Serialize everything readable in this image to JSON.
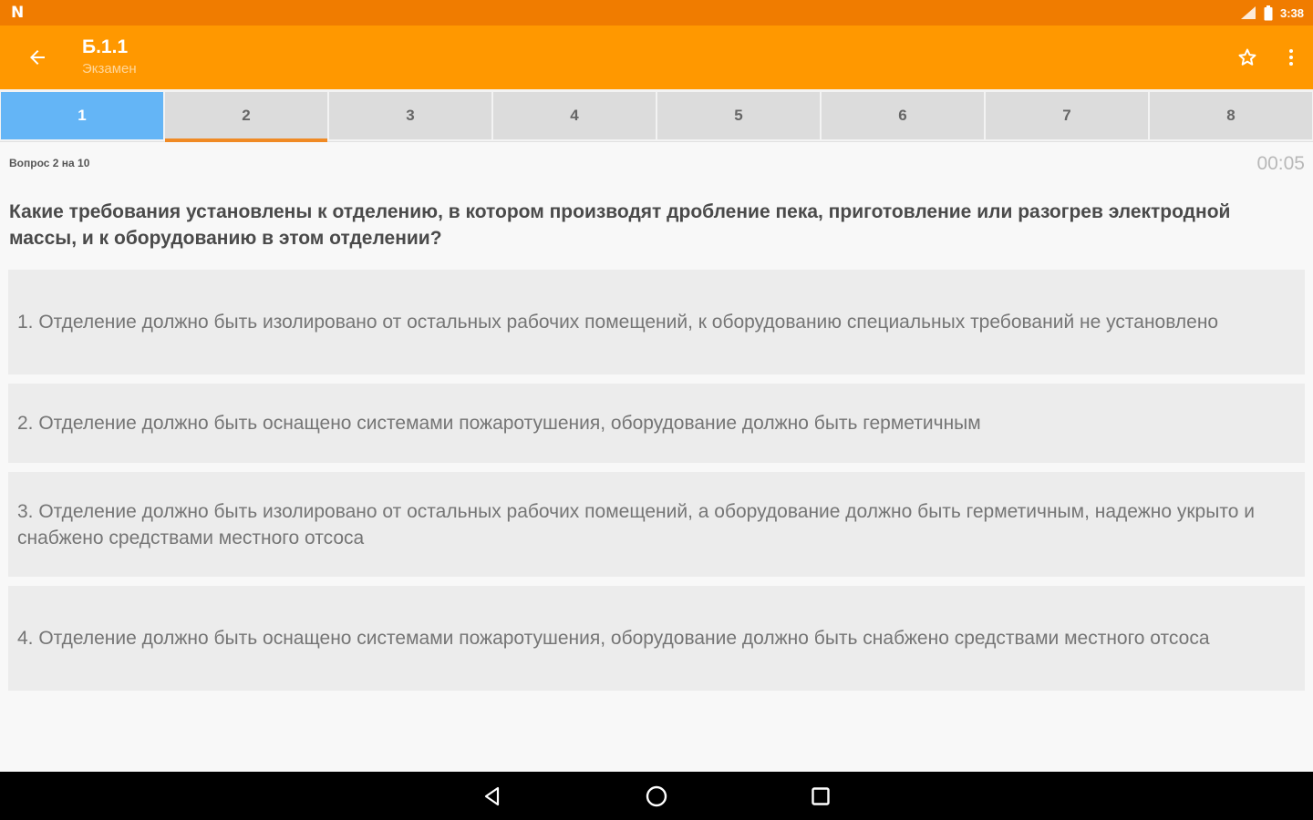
{
  "status_bar": {
    "notification_glyph": "N",
    "time": "3:38",
    "icons": [
      "signal-icon",
      "battery-icon"
    ]
  },
  "app_bar": {
    "title": "Б.1.1",
    "subtitle": "Экзамен",
    "icons": [
      "back-arrow-icon",
      "star-outline-icon",
      "more-vert-icon"
    ]
  },
  "tabs": [
    {
      "label": "1",
      "state": "current"
    },
    {
      "label": "2",
      "state": "visited"
    },
    {
      "label": "3",
      "state": "default"
    },
    {
      "label": "4",
      "state": "default"
    },
    {
      "label": "5",
      "state": "default"
    },
    {
      "label": "6",
      "state": "default"
    },
    {
      "label": "7",
      "state": "default"
    },
    {
      "label": "8",
      "state": "default"
    }
  ],
  "quiz": {
    "progress_text": "Вопрос 2 на 10",
    "timer": "00:05",
    "question": "Какие требования установлены к отделению, в котором производят дробление пека, приготовление или разогрев электродной массы, и к оборудованию в этом отделении?",
    "answers": [
      "1. Отделение должно быть изолировано от остальных рабочих помещений, к оборудованию специальных требований не установлено",
      "2. Отделение должно быть оснащено системами пожаротушения, оборудование должно быть герметичным",
      "3. Отделение должно быть изолировано от остальных рабочих помещений, а оборудование должно быть герметичным, надежно укрыто и снабжено средствами местного отсоса",
      "4. Отделение должно быть оснащено системами пожаротушения, оборудование должно быть снабжено средствами местного отсоса"
    ]
  },
  "nav_bar": {
    "icons": [
      "back-triangle-icon",
      "home-circle-icon",
      "recents-square-icon"
    ]
  },
  "colors": {
    "status_bar": "#f07c00",
    "app_bar": "#ff9800",
    "tab_current": "#64b5f6",
    "tab_visited_indicator": "#f08a24"
  }
}
